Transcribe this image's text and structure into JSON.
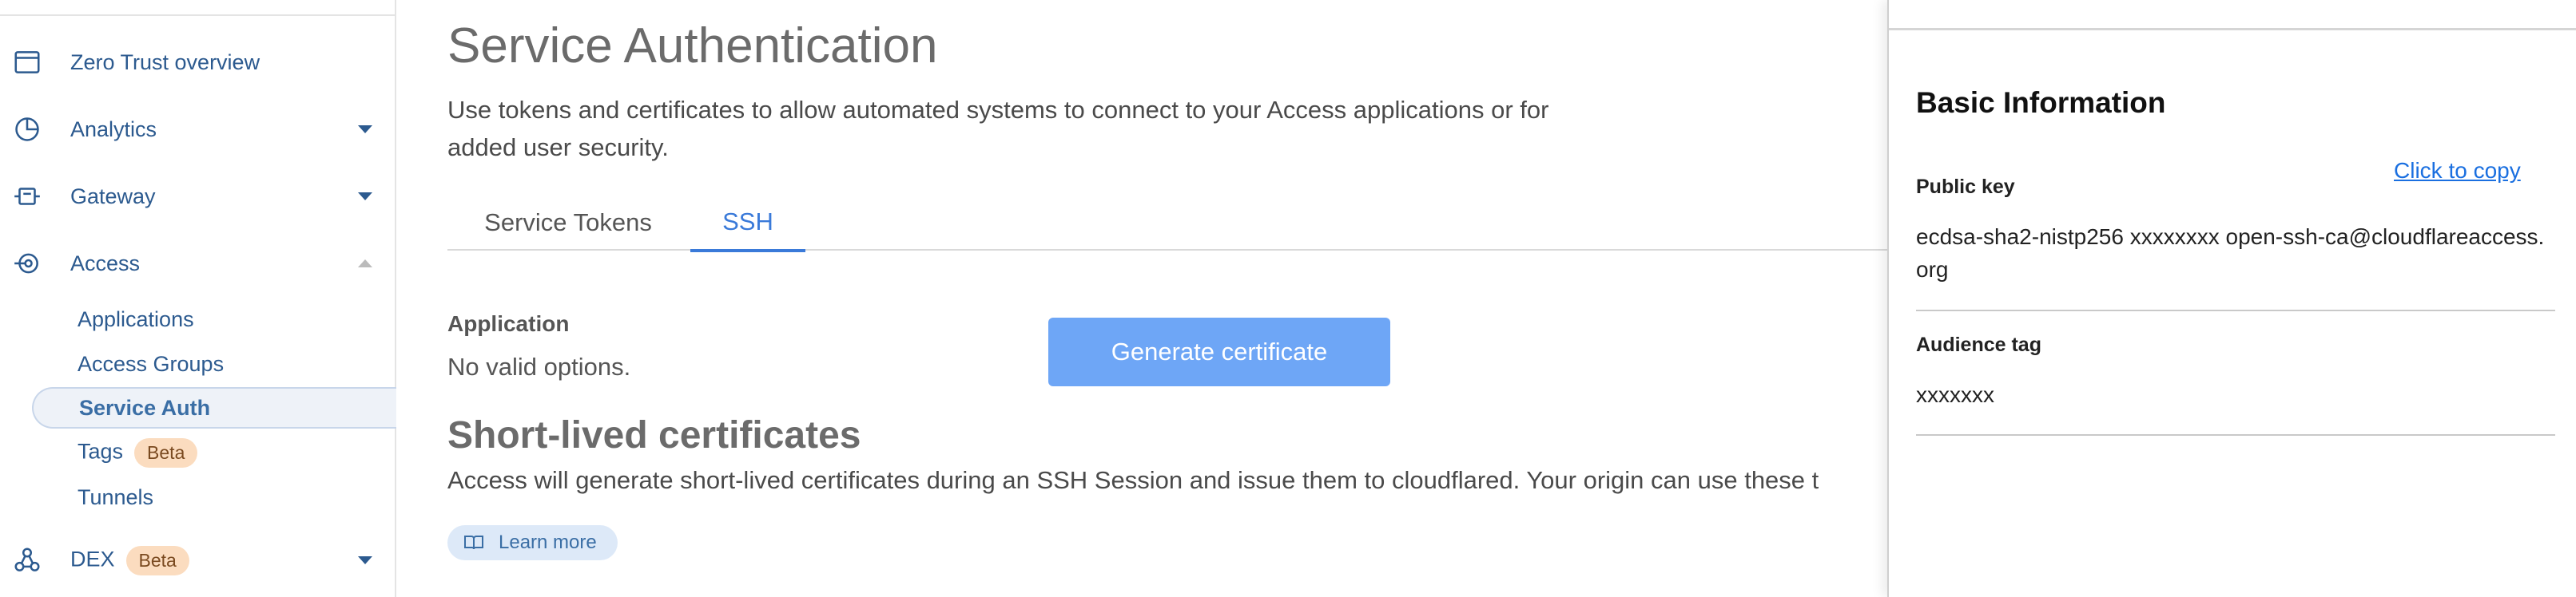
{
  "sidebar": {
    "items": [
      {
        "label": "Zero Trust overview",
        "icon": "browser-window-icon"
      },
      {
        "label": "Analytics",
        "icon": "pie-chart-icon"
      },
      {
        "label": "Gateway",
        "icon": "gateway-icon"
      },
      {
        "label": "Access",
        "icon": "access-icon"
      },
      {
        "label": "DEX",
        "icon": "dex-network-icon",
        "badge": "Beta"
      }
    ],
    "access_sub": [
      {
        "label": "Applications"
      },
      {
        "label": "Access Groups"
      },
      {
        "label": "Service Auth"
      },
      {
        "label": "Tags",
        "badge": "Beta"
      },
      {
        "label": "Tunnels"
      }
    ]
  },
  "main": {
    "title": "Service Authentication",
    "description": "Use tokens and certificates to allow automated systems to connect to your Access applications or for added user security.",
    "tabs": [
      {
        "label": "Service Tokens"
      },
      {
        "label": "SSH"
      }
    ],
    "application_label": "Application",
    "application_value": "No valid options.",
    "generate_button": "Generate certificate",
    "section_title": "Short-lived certificates",
    "section_desc": "Access will generate short-lived certificates during an SSH Session and issue them to cloudflared. Your origin can use these t",
    "learn_more": "Learn more"
  },
  "panel": {
    "heading": "Basic Information",
    "public_key_label": "Public key",
    "copy_link": "Click to copy",
    "public_key_value": "ecdsa-sha2-nistp256 xxxxxxxx open-ssh-ca@cloudflareaccess.org",
    "audience_label": "Audience tag",
    "audience_value": "xxxxxxx"
  },
  "colors": {
    "accent": "#3a7ad9",
    "nav_text": "#2c5a8f",
    "button_bg": "#6ea6f6",
    "beta_badge": "#fbdcbf",
    "link": "#1a6fe0"
  }
}
